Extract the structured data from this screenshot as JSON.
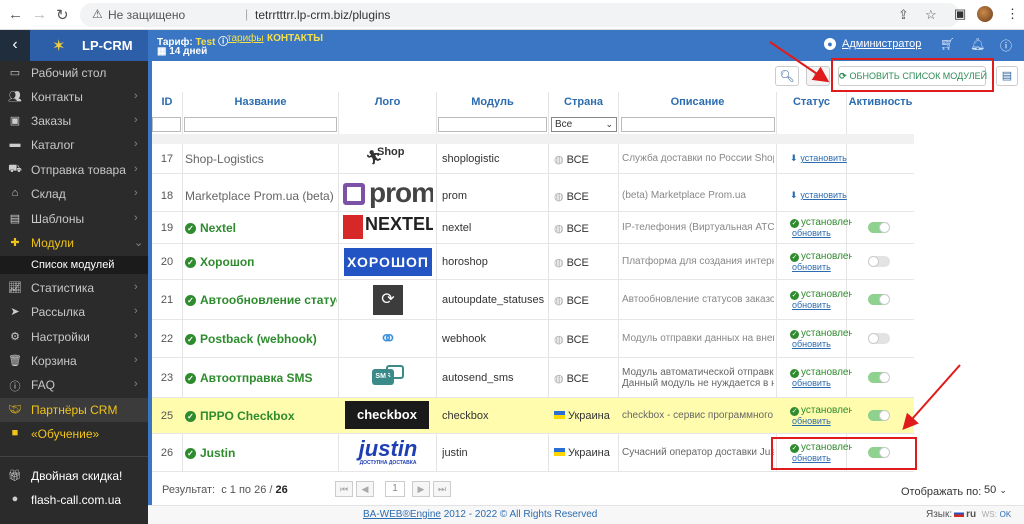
{
  "browser": {
    "security_label": "Не защищено",
    "url": "tetrrtttrr.lp-crm.biz/plugins"
  },
  "header": {
    "brand": "LP-CRM",
    "tariff_prefix": "Тариф:",
    "tariff_name": "Test",
    "tariffs_link": "тарифы",
    "contacts_link": "КОНТАКТЫ",
    "days_left": "14 дней",
    "user_name": "Администратор"
  },
  "sidebar": {
    "items": [
      {
        "label": "Рабочий стол",
        "icon": "desktop-icon"
      },
      {
        "label": "Контакты",
        "icon": "users-icon"
      },
      {
        "label": "Заказы",
        "icon": "money-icon"
      },
      {
        "label": "Каталог",
        "icon": "car-icon"
      },
      {
        "label": "Отправка товара",
        "icon": "truck-icon"
      },
      {
        "label": "Склад",
        "icon": "warehouse-icon"
      },
      {
        "label": "Шаблоны",
        "icon": "file-icon"
      },
      {
        "label": "Модули",
        "icon": "puzzle-icon"
      },
      {
        "label": "Статистика",
        "icon": "chart-icon"
      },
      {
        "label": "Рассылка",
        "icon": "send-icon"
      },
      {
        "label": "Настройки",
        "icon": "gear-icon"
      },
      {
        "label": "Корзина",
        "icon": "trash-icon"
      },
      {
        "label": "FAQ",
        "icon": "info-icon"
      },
      {
        "label": "Партнёры CRM",
        "icon": "handshake-icon"
      },
      {
        "label": "«Обучение»",
        "icon": "video-icon"
      },
      {
        "label": "Двойная скидка!",
        "icon": "gift-icon"
      },
      {
        "label": "flash-call.com.ua",
        "icon": "phone-icon"
      }
    ],
    "sub_item": "Список модулей"
  },
  "toolbar": {
    "refresh_label": "ОБНОВИТЬ СПИСОК МОДУЛЕЙ"
  },
  "table": {
    "columns": [
      "ID",
      "Название",
      "Лого",
      "Модуль",
      "Страна",
      "Описание",
      "Статус",
      "Активность"
    ],
    "country_filter": "Все",
    "rows": [
      {
        "id": "17",
        "name": "Shop-Logistics",
        "installed": false,
        "module": "shoplogistic",
        "country": "ВСЕ",
        "flag": "globe",
        "description": "Служба доставки по России Shop-Logistics",
        "status_label": "установить",
        "active": null
      },
      {
        "id": "18",
        "name": "Marketplace Prom.ua (beta)",
        "installed": false,
        "module": "prom",
        "country": "ВСЕ",
        "flag": "globe",
        "description": "(beta) Marketplace Prom.ua",
        "status_label": "установить",
        "active": null
      },
      {
        "id": "19",
        "name": "Nextel",
        "installed": true,
        "module": "nextel",
        "country": "ВСЕ",
        "flag": "globe",
        "description": "IP-телефония (Виртуальная АТС)",
        "status_label": "установлен",
        "update_label": "обновить",
        "active": true
      },
      {
        "id": "20",
        "name": "Хорошоп",
        "installed": true,
        "module": "horoshop",
        "country": "ВСЕ",
        "flag": "globe",
        "description": "Платформа для создания интернет-магазинов",
        "status_label": "установлен",
        "update_label": "обновить",
        "active": false
      },
      {
        "id": "21",
        "name": "Автообновление статусов",
        "installed": true,
        "module": "autoupdate_statuses",
        "country": "ВСЕ",
        "flag": "globe",
        "description": "Автообновление статусов заказов",
        "status_label": "установлен",
        "update_label": "обновить",
        "active": true
      },
      {
        "id": "22",
        "name": "Postback (webhook)",
        "installed": true,
        "module": "webhook",
        "country": "ВСЕ",
        "flag": "globe",
        "description": "Модуль отправки данных на внешний сервер",
        "status_label": "установлен",
        "update_label": "обновить",
        "active": false
      },
      {
        "id": "23",
        "name": "Автоотправка SMS",
        "installed": true,
        "module": "autosend_sms",
        "country": "ВСЕ",
        "flag": "globe",
        "description": "Модуль автоматической отправки",
        "description2": "Данный модуль не нуждается в настройке",
        "status_label": "установлен",
        "update_label": "обновить",
        "active": true
      },
      {
        "id": "25",
        "name": "ПРРО Checkbox",
        "installed": true,
        "module": "checkbox",
        "country": "Украина",
        "flag": "ua",
        "description": "checkbox - сервис программного РРО",
        "status_label": "установлен",
        "update_label": "обновить",
        "active": true
      },
      {
        "id": "26",
        "name": "Justin",
        "installed": true,
        "module": "justin",
        "country": "Украина",
        "flag": "ua",
        "description": "Сучасний оператор доставки Justin",
        "status_label": "установлен",
        "update_label": "обновить",
        "active": true
      }
    ],
    "logos": {
      "shop_text": "Shop",
      "prom_text": "prom",
      "nextel_text": "NEXTEL",
      "horoshop_text": "ХОРОШОП",
      "sms_text": "SMS",
      "checkbox_text": "checkbox",
      "justin_text": "justin",
      "justin_sub": "ДОСТУПНА ДОСТАВКА"
    }
  },
  "pager": {
    "result_label": "Результат:",
    "range": "с 1 по 26 /",
    "total": "26",
    "page": "1",
    "per_page_label": "Отображать по:",
    "per_page": "50"
  },
  "footer": {
    "copyright_link": "BA-WEB®Engine",
    "copyright_rest": "2012 - 2022 © All Rights Reserved",
    "lang_label": "Язык:",
    "lang_code": "ru",
    "ws_label": "WS:",
    "ws_value": "OK"
  }
}
